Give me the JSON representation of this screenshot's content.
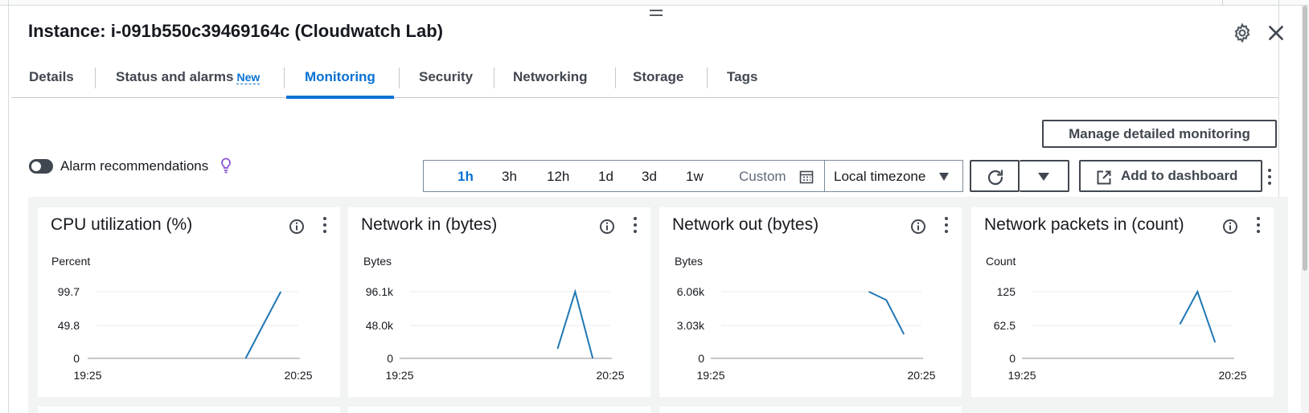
{
  "header": {
    "title": "Instance: i-091b550c39469164c (Cloudwatch Lab)"
  },
  "tabs": [
    {
      "label": "Details"
    },
    {
      "label": "Status and alarms",
      "badge": "New"
    },
    {
      "label": "Monitoring",
      "active": true
    },
    {
      "label": "Security"
    },
    {
      "label": "Networking"
    },
    {
      "label": "Storage"
    },
    {
      "label": "Tags"
    }
  ],
  "toolbar": {
    "manage_label": "Manage detailed monitoring",
    "alarm_label": "Alarm recommendations",
    "alarm_toggle_on": false,
    "ranges": [
      "1h",
      "3h",
      "12h",
      "1d",
      "3d",
      "1w"
    ],
    "active_range": "1h",
    "custom_label": "Custom",
    "timezone_label": "Local timezone",
    "add_dashboard_label": "Add to dashboard"
  },
  "colors": {
    "accent": "#0972d3",
    "series": "#1f77b4",
    "gridline": "#e9ebed",
    "axis": "#c6c6cd"
  },
  "icons": {
    "settings": "gear-icon",
    "close": "close-icon",
    "alarm_hint": "lightbulb-icon",
    "calendar": "calendar-icon",
    "refresh": "refresh-icon",
    "dropdown": "caret-down-icon",
    "external": "external-link-icon",
    "info": "info-icon",
    "more": "more-vertical-icon"
  },
  "cards": [
    {
      "title": "CPU utilization (%)",
      "unit": "Percent",
      "ymax_label": "99.7",
      "ymid_label": "49.8",
      "ymin_label": "0",
      "x_start": "19:25",
      "x_end": "20:25"
    },
    {
      "title": "Network in (bytes)",
      "unit": "Bytes",
      "ymax_label": "96.1k",
      "ymid_label": "48.0k",
      "ymin_label": "0",
      "x_start": "19:25",
      "x_end": "20:25"
    },
    {
      "title": "Network out (bytes)",
      "unit": "Bytes",
      "ymax_label": "6.06k",
      "ymid_label": "3.03k",
      "ymin_label": "0",
      "x_start": "19:25",
      "x_end": "20:25"
    },
    {
      "title": "Network packets in (count)",
      "unit": "Count",
      "ymax_label": "125",
      "ymid_label": "62.5",
      "ymin_label": "0",
      "x_start": "19:25",
      "x_end": "20:25"
    }
  ],
  "chart_data": [
    {
      "type": "line",
      "title": "CPU utilization (%)",
      "ylabel": "Percent",
      "x_tick_labels": [
        "19:25",
        "20:25"
      ],
      "x_range_minutes": [
        0,
        60
      ],
      "ylim": [
        0,
        99.7
      ],
      "y_ticks": [
        "0",
        "49.8",
        "99.7"
      ],
      "series": [
        {
          "x_minutes": [
            45,
            50,
            55
          ],
          "values": [
            0,
            50,
            99.7
          ]
        }
      ]
    },
    {
      "type": "line",
      "title": "Network in (bytes)",
      "ylabel": "Bytes",
      "x_tick_labels": [
        "19:25",
        "20:25"
      ],
      "x_range_minutes": [
        0,
        60
      ],
      "ylim": [
        0,
        96100
      ],
      "y_ticks": [
        "0",
        "48.0k",
        "96.1k"
      ],
      "series": [
        {
          "x_minutes": [
            45,
            50,
            55
          ],
          "values": [
            14000,
            96100,
            0
          ]
        }
      ]
    },
    {
      "type": "line",
      "title": "Network out (bytes)",
      "ylabel": "Bytes",
      "x_tick_labels": [
        "19:25",
        "20:25"
      ],
      "x_range_minutes": [
        0,
        60
      ],
      "ylim": [
        0,
        6060
      ],
      "y_ticks": [
        "0",
        "3.03k",
        "6.06k"
      ],
      "series": [
        {
          "x_minutes": [
            45,
            50,
            55
          ],
          "values": [
            6060,
            5300,
            2200
          ]
        }
      ]
    },
    {
      "type": "line",
      "title": "Network packets in (count)",
      "ylabel": "Count",
      "x_tick_labels": [
        "19:25",
        "20:25"
      ],
      "x_range_minutes": [
        0,
        60
      ],
      "ylim": [
        0,
        125
      ],
      "y_ticks": [
        "0",
        "62.5",
        "125"
      ],
      "series": [
        {
          "x_minutes": [
            45,
            50,
            55
          ],
          "values": [
            64,
            125,
            30
          ]
        }
      ]
    }
  ]
}
